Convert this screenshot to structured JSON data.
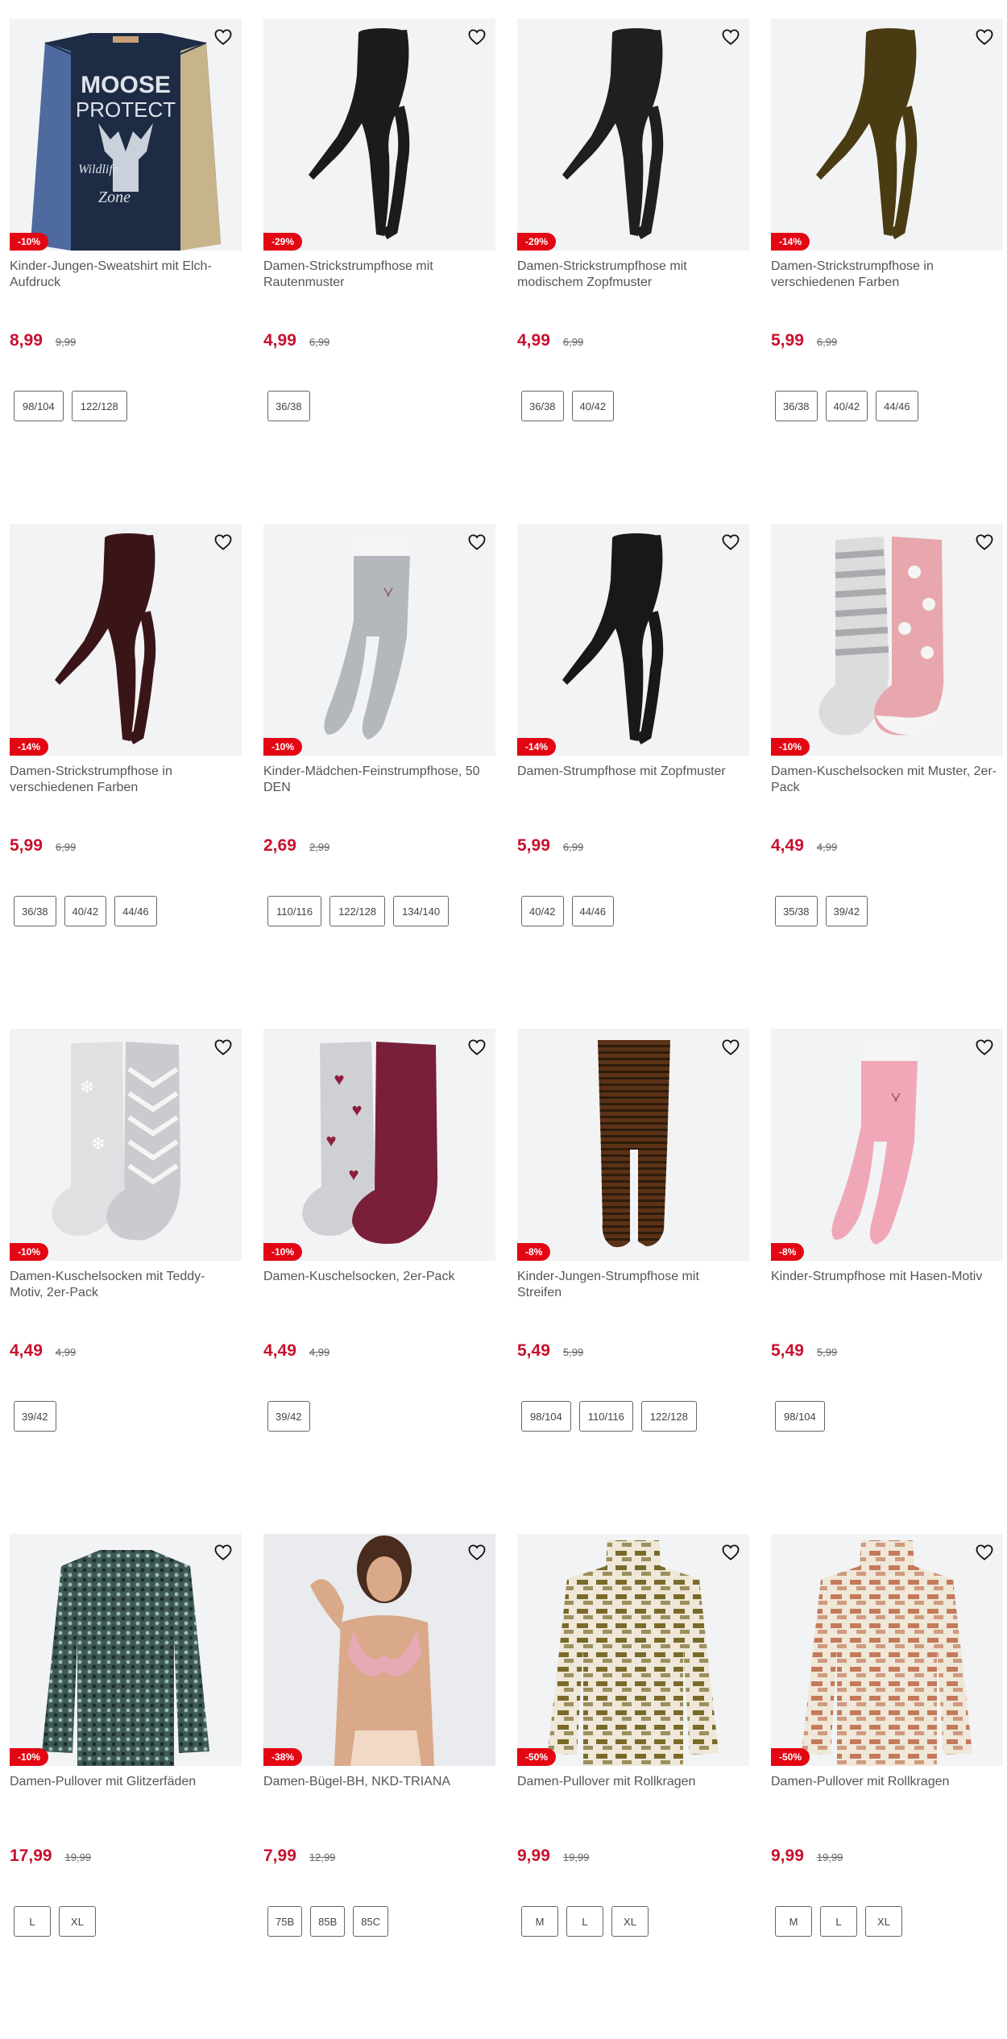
{
  "products": [
    {
      "title": "Kinder-Jungen-Sweatshirt mit Elch-Aufdruck",
      "price": "8,99",
      "old_price": "9,99",
      "discount": "-10%",
      "sizes": [
        "98/104",
        "122/128"
      ],
      "image": "moose-sweatshirt",
      "sweatshirt_print": [
        "MOOSE",
        "PROTECT",
        "Wildlife",
        "Zone"
      ]
    },
    {
      "title": "Damen-Strickstrumpfhose mit Rautenmuster",
      "price": "4,99",
      "old_price": "6,99",
      "discount": "-29%",
      "sizes": [
        "36/38"
      ],
      "image": "tights",
      "color": "#1b1b1b"
    },
    {
      "title": "Damen-Strickstrumpfhose mit modischem Zopfmuster",
      "price": "4,99",
      "old_price": "6,99",
      "discount": "-29%",
      "sizes": [
        "36/38",
        "40/42"
      ],
      "image": "tights",
      "color": "#1f1f1f"
    },
    {
      "title": "Damen-Strickstrumpfhose in verschiedenen Farben",
      "price": "5,99",
      "old_price": "6,99",
      "discount": "-14%",
      "sizes": [
        "36/38",
        "40/42",
        "44/46"
      ],
      "image": "tights",
      "color": "#4a3c12"
    },
    {
      "title": "Damen-Strickstrumpfhose in verschiedenen Farben",
      "price": "5,99",
      "old_price": "6,99",
      "discount": "-14%",
      "sizes": [
        "36/38",
        "40/42",
        "44/46"
      ],
      "image": "tights",
      "color": "#3a1518"
    },
    {
      "title": "Kinder-Mädchen-Feinstrumpfhose, 50 DEN",
      "price": "2,69",
      "old_price": "2,99",
      "discount": "-10%",
      "sizes": [
        "110/116",
        "122/128",
        "134/140"
      ],
      "image": "kids-tights",
      "color": "#b4b8bd"
    },
    {
      "title": "Damen-Strumpfhose mit Zopfmuster",
      "price": "5,99",
      "old_price": "6,99",
      "discount": "-14%",
      "sizes": [
        "40/42",
        "44/46"
      ],
      "image": "tights",
      "color": "#181818"
    },
    {
      "title": "Damen-Kuschelsocken mit Muster, 2er-Pack",
      "price": "4,49",
      "old_price": "4,99",
      "discount": "-10%",
      "sizes": [
        "35/38",
        "39/42"
      ],
      "image": "socks-pink",
      "color": "#e8a6ad"
    },
    {
      "title": "Damen-Kuschelsocken mit Teddy-Motiv, 2er-Pack",
      "price": "4,49",
      "old_price": "4,99",
      "discount": "-10%",
      "sizes": [
        "39/42"
      ],
      "image": "socks-grey",
      "color": "#c9cbcf"
    },
    {
      "title": "Damen-Kuschelsocken, 2er-Pack",
      "price": "4,49",
      "old_price": "4,99",
      "discount": "-10%",
      "sizes": [
        "39/42"
      ],
      "image": "socks-heart",
      "color": "#7a1f3a"
    },
    {
      "title": "Kinder-Jungen-Strumpfhose mit Streifen",
      "price": "5,49",
      "old_price": "5,99",
      "discount": "-8%",
      "sizes": [
        "98/104",
        "110/116",
        "122/128"
      ],
      "image": "kids-tights-striped",
      "color": "#5b3216"
    },
    {
      "title": "Kinder-Strumpfhose mit Hasen-Motiv",
      "price": "5,49",
      "old_price": "5,99",
      "discount": "-8%",
      "sizes": [
        "98/104"
      ],
      "image": "kids-tights",
      "color": "#f0a8b8"
    },
    {
      "title": "Damen-Pullover mit Glitzerfäden",
      "price": "17,99",
      "old_price": "19,99",
      "discount": "-10%",
      "sizes": [
        "L",
        "XL"
      ],
      "image": "sweater-knit",
      "color": "#3d5a55"
    },
    {
      "title": "Damen-Bügel-BH, NKD-TRIANA",
      "price": "7,99",
      "old_price": "12,99",
      "discount": "-38%",
      "sizes": [
        "75B",
        "85B",
        "85C"
      ],
      "image": "bra-model",
      "color": "#e6aab4"
    },
    {
      "title": "Damen-Pullover mit Rollkragen",
      "price": "9,99",
      "old_price": "19,99",
      "discount": "-50%",
      "sizes": [
        "M",
        "L",
        "XL"
      ],
      "image": "turtleneck",
      "color": "#7a6a2a"
    },
    {
      "title": "Damen-Pullover mit Rollkragen",
      "price": "9,99",
      "old_price": "19,99",
      "discount": "-50%",
      "sizes": [
        "M",
        "L",
        "XL"
      ],
      "image": "turtleneck",
      "color": "#c47a5a"
    }
  ],
  "colors": {
    "price": "#c8102e",
    "badge": "#e30613",
    "image_bg": "#f2f3f4"
  }
}
